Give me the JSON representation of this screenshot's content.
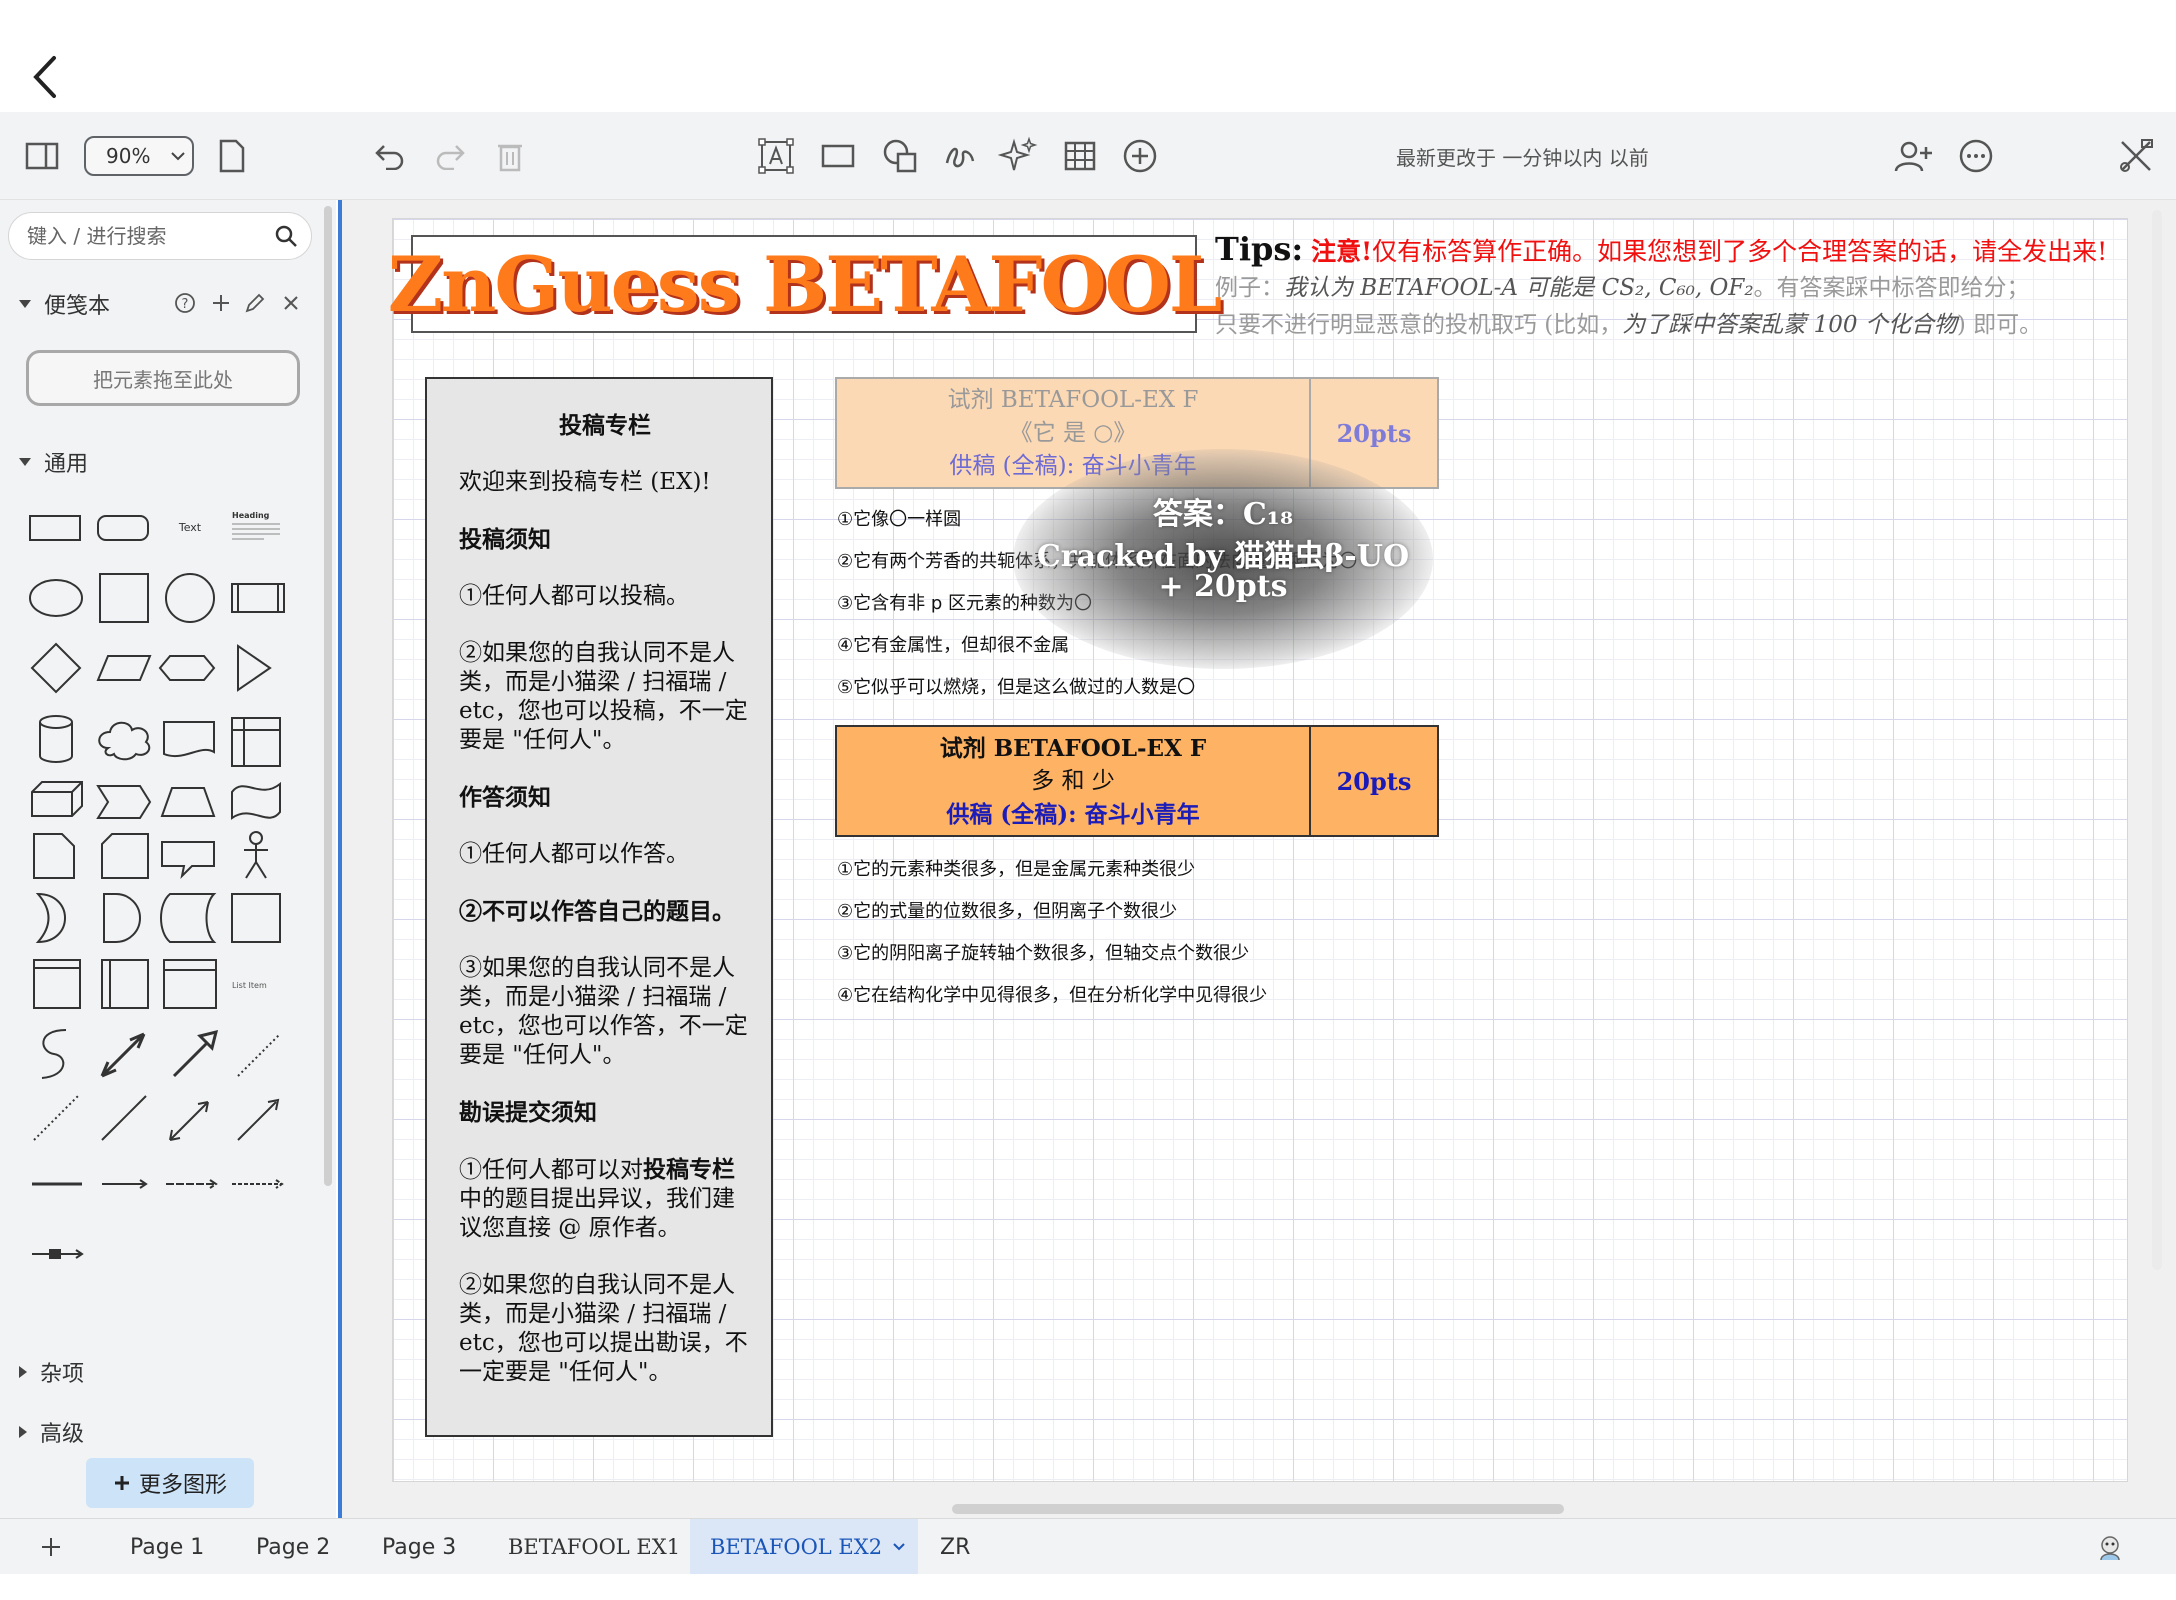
{
  "toolbar": {
    "zoom": "90%",
    "status": "最新更改于 一分钟以内 以前"
  },
  "sidebar": {
    "search_placeholder": "键入 / 进行搜索",
    "scratchpad_label": "便笺本",
    "drop_zone": "把元素拖至此处",
    "general_label": "通用",
    "misc_label": "杂项",
    "advanced_label": "高级",
    "more_shapes": "更多图形",
    "text_shape": "Text",
    "heading_shape": "Heading",
    "list_item_shape": "List Item"
  },
  "canvas": {
    "title": "ZnGuess BETAFOOL",
    "tips": {
      "label": "Tips:",
      "warn": "注意!",
      "main": "仅有标答算作正确。如果您想到了多个合理答案的话，请全发出来!",
      "example_prefix": "例子：",
      "example_body": "我认为 BETAFOOL-A 可能是 CS₂, C₆₀, OF₂",
      "example_suffix": "。有答案踩中标答即给分；",
      "line3_prefix": "只要不进行明显恶意的投机取巧 (比如，",
      "line3_italic": "为了踩中答案乱蒙 100 个化合物",
      "line3_suffix": ") 即可。"
    },
    "panel": {
      "title": "投稿专栏",
      "welcome": "欢迎来到投稿专栏 (EX)!",
      "submit_heading": "投稿须知",
      "submit_1": "①任何人都可以投稿。",
      "submit_2": "②如果您的自我认同不是人类，而是小猫梁 / 扫福瑞 / etc，您也可以投稿，不一定要是 \"任何人\"。",
      "answer_heading": "作答须知",
      "answer_1": "①任何人都可以作答。",
      "answer_2": "②不可以作答自己的题目。",
      "answer_3": "③如果您的自我认同不是人类，而是小猫梁 / 扫福瑞 / etc，您也可以作答，不一定要是 \"任何人\"。",
      "errata_heading": "勘误提交须知",
      "errata_1a": "①任何人都可以对",
      "errata_1b": "投稿专栏",
      "errata_1c": "中的题目提出异议，我们建议您直接 @ 原作者。",
      "errata_2": "②如果您的自我认同不是人类，而是小猫梁 / 扫福瑞 / etc，您也可以提出勘误，不一定要是 \"任何人\"。"
    },
    "questions": [
      {
        "title": "试剂 BETAFOOL-EX F",
        "subtitle": "《它 是 ○》",
        "author": "供稿 (全稿): 奋斗小青年",
        "points": "20pts",
        "clues": [
          "①它像〇一样圆",
          "②它有两个芳香的共轭体系，共轭体系所在面的法向量点乘后为〇",
          "③它含有非 p 区元素的种数为〇",
          "④它有金属性，但却很不金属",
          "⑤它似乎可以燃烧，但是这么做过的人数是〇"
        ]
      },
      {
        "title": "试剂 BETAFOOL-EX F",
        "subtitle": "多 和 少",
        "author": "供稿 (全稿): 奋斗小青年",
        "points": "20pts",
        "clues": [
          "①它的元素种类很多，但是金属元素种类很少",
          "②它的式量的位数很多，但阴离子个数很少",
          "③它的阴阳离子旋转轴个数很多，但轴交点个数很少",
          "④它在结构化学中见得很多，但在分析化学中见得很少"
        ]
      }
    ],
    "overlay": {
      "answer": "答案：C₁₈",
      "cracked": "Cracked by 猫猫虫β-UO",
      "bonus": "+ 20pts"
    }
  },
  "tabs": [
    "Page 1",
    "Page 2",
    "Page 3",
    "BETAFOOL EX1",
    "BETAFOOL EX2",
    "ZR"
  ]
}
